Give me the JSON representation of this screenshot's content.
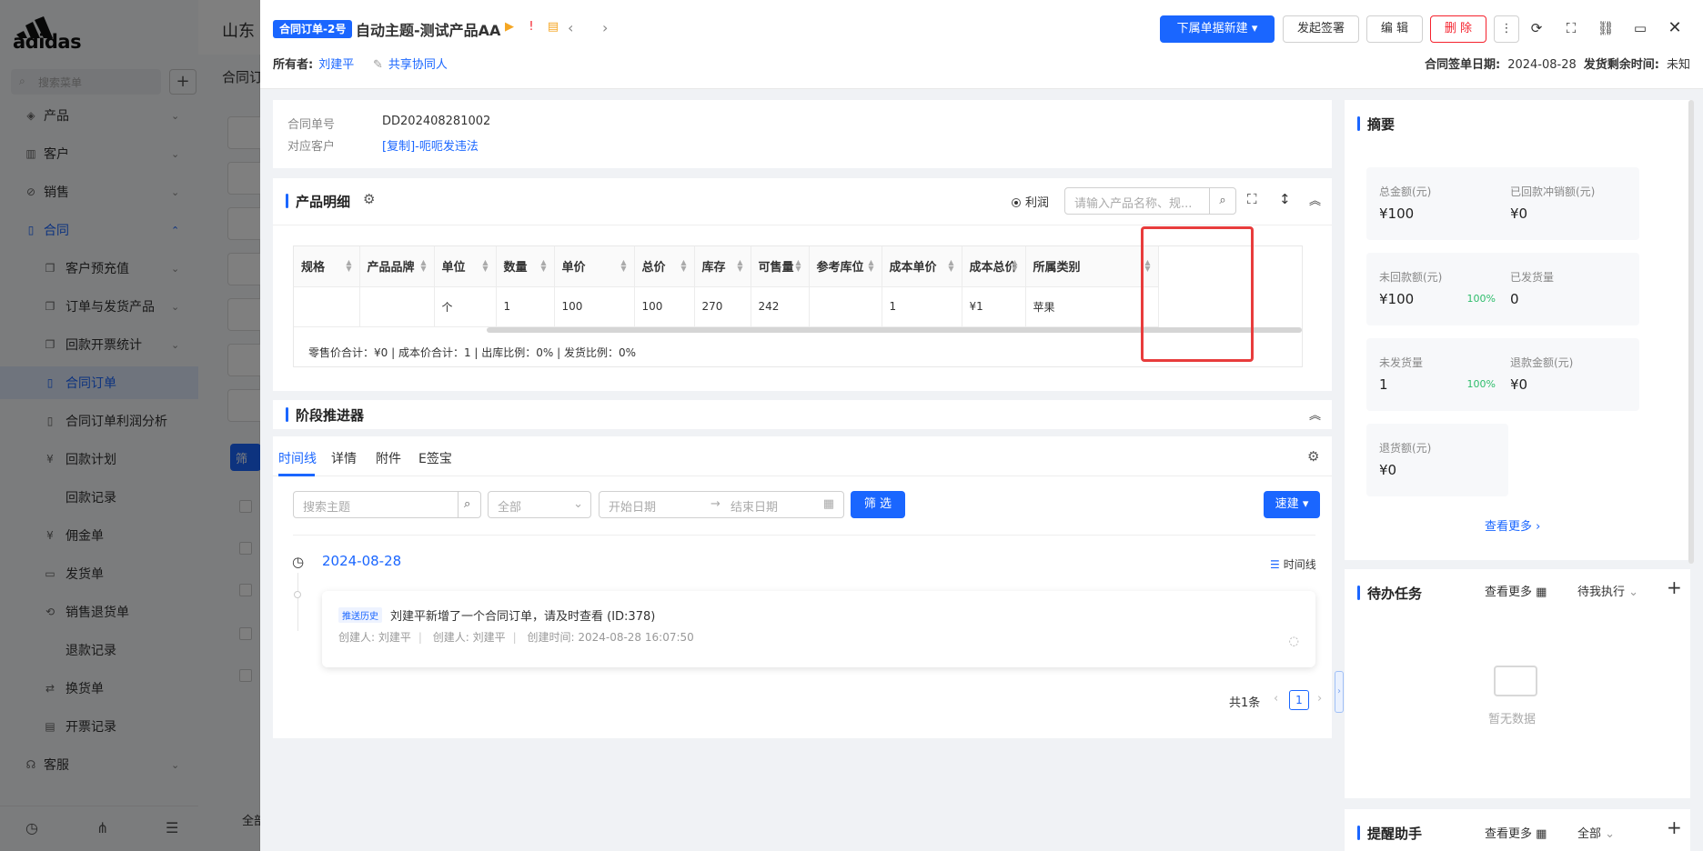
{
  "background": {
    "brand": "adidas",
    "search_placeholder": "搜索菜单",
    "plus": "+",
    "title_partial": "山东",
    "tab_partial": "合同订",
    "bottom_row_partial": "全部",
    "menu": [
      {
        "label": "产品",
        "icon": "box-icon",
        "chevron": "⌄"
      },
      {
        "label": "客户",
        "icon": "chart-icon",
        "chevron": "⌄"
      },
      {
        "label": "销售",
        "icon": "compass-icon",
        "chevron": "⌄"
      },
      {
        "label": "合同",
        "icon": "document-icon",
        "chevron": "⌃"
      },
      {
        "label": "客户预充值",
        "icon": "copy-icon",
        "chevron": "⌄"
      },
      {
        "label": "订单与发货产品",
        "icon": "copy-icon",
        "chevron": "⌄"
      },
      {
        "label": "回款开票统计",
        "icon": "copy-icon",
        "chevron": "⌄"
      },
      {
        "label": "合同订单",
        "icon": "document-icon",
        "chevron": ""
      },
      {
        "label": "合同订单利润分析",
        "icon": "document-icon",
        "chevron": ""
      },
      {
        "label": "回款计划",
        "icon": "money-icon",
        "chevron": ""
      },
      {
        "label": "回款记录",
        "icon": "",
        "chevron": ""
      },
      {
        "label": "佣金单",
        "icon": "money-icon",
        "chevron": ""
      },
      {
        "label": "发货单",
        "icon": "truck-icon",
        "chevron": ""
      },
      {
        "label": "销售退货单",
        "icon": "return-icon",
        "chevron": ""
      },
      {
        "label": "退款记录",
        "icon": "",
        "chevron": ""
      },
      {
        "label": "换货单",
        "icon": "swap-icon",
        "chevron": ""
      },
      {
        "label": "开票记录",
        "icon": "invoice-icon",
        "chevron": ""
      },
      {
        "label": "客服",
        "icon": "headset-icon",
        "chevron": "⌄"
      }
    ],
    "filter_btn": "筛"
  },
  "header": {
    "tag": "合同订单-2号",
    "title": "自动主题-测试产品AA",
    "owner_label": "所有者:",
    "owner_name": "刘建平",
    "share_label": "共享协同人",
    "btn_sub_create": "下属单据新建",
    "btn_sign": "发起签署",
    "btn_edit": "编 辑",
    "btn_delete": "删 除",
    "sign_date_label": "合同签单日期:",
    "sign_date": "2024-08-28",
    "ship_remaining_label": "发货剩余时间:",
    "ship_remaining": "未知"
  },
  "info": {
    "order_no_label": "合同单号",
    "order_no": "DD202408281002",
    "customer_label": "对应客户",
    "customer": "[复制]-呃呃发违法"
  },
  "products": {
    "title": "产品明细",
    "profit_label": "利润",
    "search_placeholder": "请输入产品名称、规...",
    "columns": [
      "规格",
      "产品品牌",
      "单位",
      "数量",
      "单价",
      "总价",
      "库存",
      "可售量",
      "参考库位",
      "成本单价",
      "成本总价",
      "所属类别"
    ],
    "row": [
      "",
      "",
      "个",
      "1",
      "100",
      "100",
      "270",
      "242",
      "",
      "1",
      "¥1",
      "苹果"
    ],
    "summary": "零售价合计：¥0 |   成本价合计：1 |   出库比例：0% |   发货比例：0%"
  },
  "stage": {
    "title": "阶段推进器"
  },
  "timeline": {
    "tabs": [
      "时间线",
      "详情",
      "附件",
      "E签宝"
    ],
    "search_placeholder": "搜索主题",
    "select_value": "全部",
    "start_date": "开始日期",
    "end_date": "结束日期",
    "filter_btn": "筛 选",
    "quick_btn": "速建",
    "date": "2024-08-28",
    "mode_label": "时间线",
    "event": {
      "tag": "推送历史",
      "text": "刘建平新增了一个合同订单，请及时查看 (ID:378)",
      "creator1": "创建人: 刘建平",
      "creator2": "创建人: 刘建平",
      "created_time": "创建时间: 2024-08-28 16:07:50"
    },
    "total": "共1条",
    "page": "1"
  },
  "summary_panel": {
    "title": "摘要",
    "cells": [
      {
        "label": "总金额(元)",
        "value": "¥100",
        "pct": ""
      },
      {
        "label": "已回款冲销额(元)",
        "value": "¥0",
        "pct": ""
      },
      {
        "label": "未回款额(元)",
        "value": "¥100",
        "pct": "100%"
      },
      {
        "label": "已发货量",
        "value": "0",
        "pct": ""
      },
      {
        "label": "未发货量",
        "value": "1",
        "pct": "100%"
      },
      {
        "label": "退款金额(元)",
        "value": "¥0",
        "pct": ""
      },
      {
        "label": "退货额(元)",
        "value": "¥0",
        "pct": ""
      }
    ],
    "more": "查看更多"
  },
  "todo": {
    "title": "待办任务",
    "more": "查看更多",
    "filter": "待我执行",
    "empty": "暂无数据"
  },
  "reminder": {
    "title": "提醒助手",
    "more": "查看更多",
    "filter": "全部"
  },
  "colors": {
    "primary": "#1a66ff",
    "danger": "#f5222d",
    "success": "#2ebd6b",
    "highlight_box": "#e83c3c"
  }
}
